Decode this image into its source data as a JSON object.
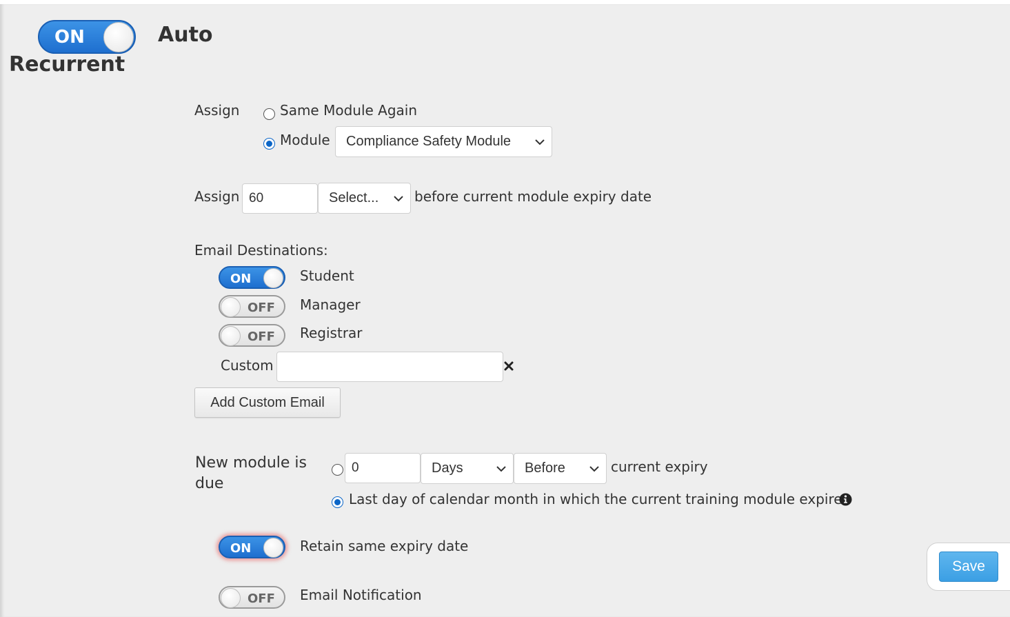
{
  "header": {
    "toggle_text": "ON",
    "title_line1": "Auto",
    "title_line2": "Recurrent"
  },
  "assign_section": {
    "label": "Assign",
    "option_same": "Same Module Again",
    "option_module": "Module",
    "module_selected": "Compliance Safety Module",
    "selected_option": "module"
  },
  "assign_timing": {
    "label": "Assign",
    "value": "60",
    "unit_selected": "Select...",
    "suffix": "before current module expiry date"
  },
  "email": {
    "heading": "Email Destinations:",
    "destinations": [
      {
        "state": "ON",
        "label": "Student"
      },
      {
        "state": "OFF",
        "label": "Manager"
      },
      {
        "state": "OFF",
        "label": "Registrar"
      }
    ],
    "custom_label": "Custom",
    "custom_value": "",
    "clear_icon": "close-x-icon",
    "add_button": "Add Custom Email"
  },
  "due": {
    "label": "New module is due",
    "value": "0",
    "unit_selected": "Days",
    "relation_selected": "Before",
    "suffix": "current expiry",
    "option_last_day": "Last day of calendar month in which the current training module expires",
    "info_icon": "info-icon",
    "selected_option": "last_day"
  },
  "retain": {
    "state": "ON",
    "label": "Retain same expiry date"
  },
  "notification": {
    "state": "OFF",
    "label": "Email Notification"
  },
  "save_label": "Save",
  "colors": {
    "toggle_on": "#1e6fcf",
    "panel_bg": "#eeeeee",
    "save_bg": "#3b9fe4"
  }
}
